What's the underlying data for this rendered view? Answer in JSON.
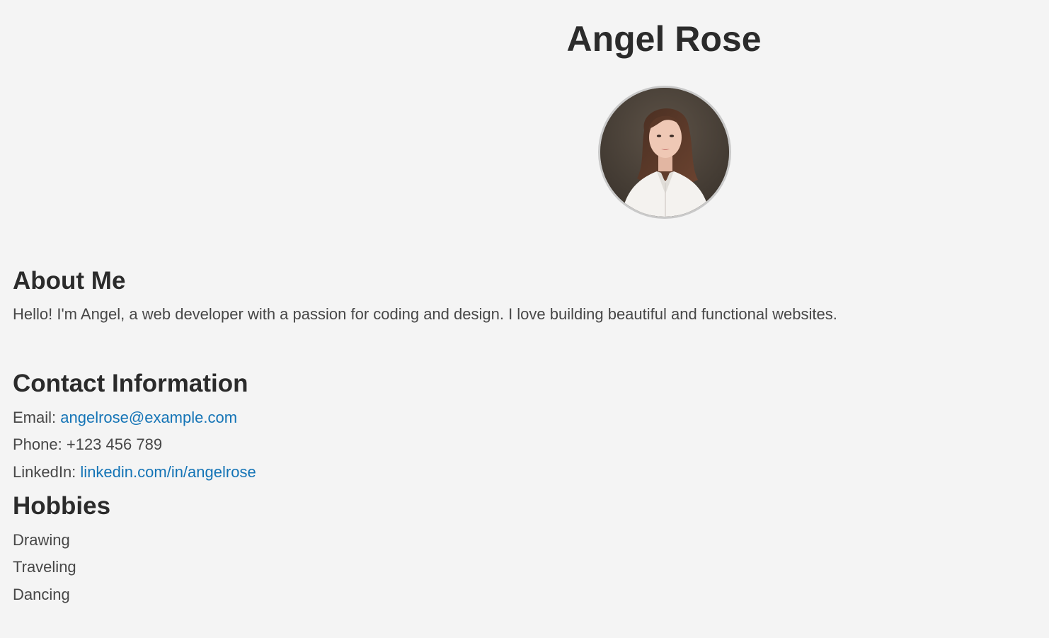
{
  "profile": {
    "name": "Angel Rose"
  },
  "about": {
    "heading": "About Me",
    "text": "Hello! I'm Angel, a web developer with a passion for coding and design. I love building beautiful and functional websites."
  },
  "contact": {
    "heading": "Contact Information",
    "email_label": "Email:",
    "email_value": "angelrose@example.com",
    "phone_label": "Phone:",
    "phone_value": "+123 456 789",
    "linkedin_label": "LinkedIn:",
    "linkedin_value": "linkedin.com/in/angelrose"
  },
  "hobbies": {
    "heading": "Hobbies",
    "items": [
      "Drawing",
      "Traveling",
      "Dancing"
    ]
  },
  "colors": {
    "background": "#f4f4f4",
    "heading": "#2b2b2b",
    "body_text": "#474747",
    "link": "#1474b6",
    "avatar_border": "#c9c9c9"
  }
}
